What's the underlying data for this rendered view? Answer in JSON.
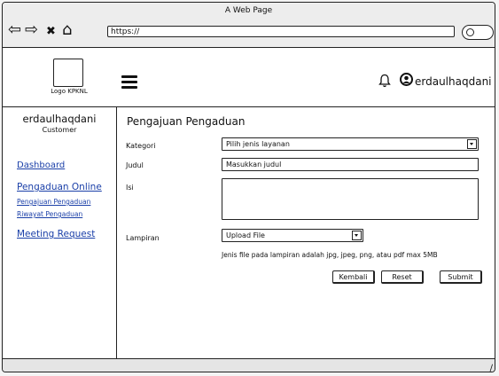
{
  "browser": {
    "title": "A Web Page",
    "url": "https://",
    "nav": {
      "back": "⇦",
      "forward": "⇨",
      "close": "✖",
      "home": "⌂"
    }
  },
  "header": {
    "logo_label": "Logo KPKNL",
    "username": "erdaulhaqdani"
  },
  "sidebar": {
    "user_name": "erdaulhaqdani",
    "user_role": "Customer",
    "links": [
      {
        "label": "Dashboard"
      },
      {
        "label": "Pengaduan Online"
      },
      {
        "label": "Pengajuan Pengaduan"
      },
      {
        "label": "Riwayat Pengaduan"
      },
      {
        "label": "Meeting Request"
      }
    ]
  },
  "form": {
    "title": "Pengajuan Pengaduan",
    "kategori_label": "Kategori",
    "kategori_value": "Pilih jenis layanan",
    "judul_label": "Judul",
    "judul_placeholder": "Masukkan judul",
    "isi_label": "Isi",
    "lampiran_label": "Lampiran",
    "lampiran_value": "Upload File",
    "hint": "Jenis file pada lampiran adalah jpg, jpeg, png, atau pdf max 5MB",
    "buttons": {
      "kembali": "Kembali",
      "reset": "Reset",
      "submit": "Submit"
    }
  },
  "statusbar": {
    "grip": "∕"
  }
}
